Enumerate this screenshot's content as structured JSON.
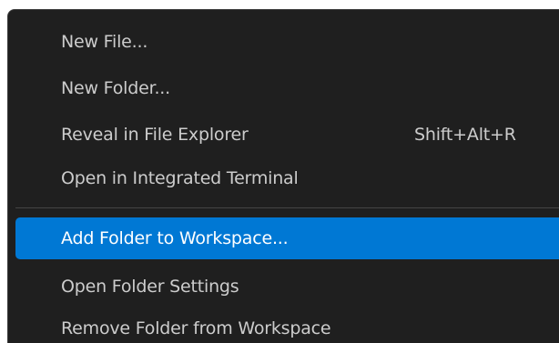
{
  "menu": {
    "items": [
      {
        "label": "New File...",
        "keybinding": ""
      },
      {
        "label": "New Folder...",
        "keybinding": ""
      },
      {
        "label": "Reveal in File Explorer",
        "keybinding": "Shift+Alt+R"
      },
      {
        "label": "Open in Integrated Terminal",
        "keybinding": ""
      },
      {
        "label": "Add Folder to Workspace...",
        "keybinding": ""
      },
      {
        "label": "Open Folder Settings",
        "keybinding": ""
      },
      {
        "label": "Remove Folder from Workspace",
        "keybinding": ""
      }
    ],
    "selected_label": "Add Folder to Workspace..."
  },
  "colors": {
    "menu_background": "#1f1f1f",
    "text": "#cccccc",
    "selection_background": "#0078d4",
    "selection_text": "#ffffff",
    "separator": "#454545"
  }
}
